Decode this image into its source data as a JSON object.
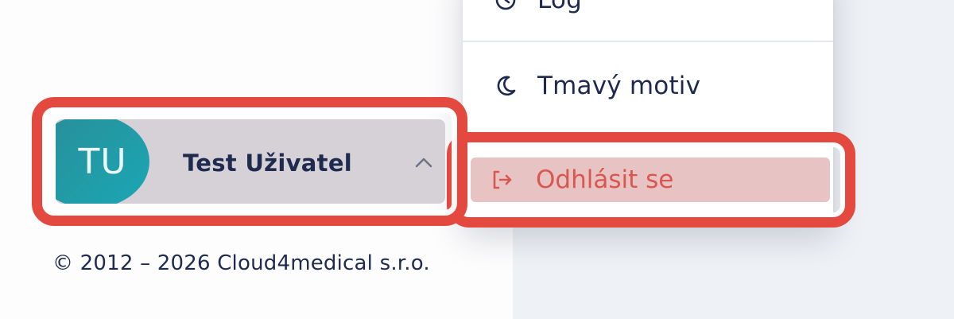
{
  "menu": {
    "log_label": "Log",
    "dark_mode_label": "Tmavý motiv",
    "logout_label": "Odhlásit se"
  },
  "user": {
    "initials": "TU",
    "name": "Test Uživatel"
  },
  "footer": {
    "copyright": "© 2012 – 2026 Cloud4medical s.r.o."
  },
  "colors": {
    "highlight": "#e3493f",
    "logout_text": "#d9574f",
    "avatar": "#1aa7b5",
    "text": "#1f2a4f"
  }
}
